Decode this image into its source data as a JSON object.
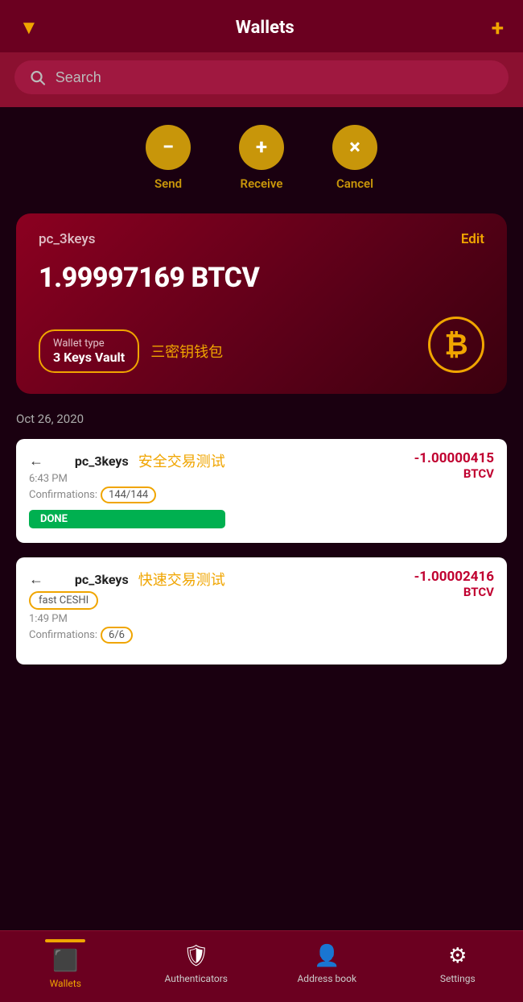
{
  "header": {
    "title": "Wallets",
    "filter_icon": "▼",
    "add_icon": "+"
  },
  "search": {
    "placeholder": "Search"
  },
  "actions": [
    {
      "icon": "−",
      "label": "Send"
    },
    {
      "icon": "+",
      "label": "Receive"
    },
    {
      "icon": "×",
      "label": "Cancel"
    }
  ],
  "wallet_card": {
    "name": "pc_3keys",
    "edit_label": "Edit",
    "balance": "1.99997169 BTCV",
    "type_label": "Wallet type",
    "type_value": "3 Keys Vault",
    "type_chinese": "三密钥钱包",
    "bitcoin_symbol": "₿"
  },
  "transactions": {
    "date": "Oct 26, 2020",
    "items": [
      {
        "wallet": "pc_3keys",
        "chinese": "安全交易测试",
        "time": "6:43 PM",
        "confirmations_label": "Confirmations:",
        "confirmations": "144/144",
        "status": "DONE",
        "amount": "-1.00000415",
        "currency": "BTCV"
      },
      {
        "wallet": "pc_3keys",
        "chinese": "快速交易测试",
        "memo": "fast CESHI",
        "time": "1:49 PM",
        "confirmations_label": "Confirmations:",
        "confirmations": "6/6",
        "amount": "-1.00002416",
        "currency": "BTCV"
      }
    ]
  },
  "bottom_nav": [
    {
      "id": "wallets",
      "label": "Wallets",
      "icon": "▦",
      "active": true
    },
    {
      "id": "authenticators",
      "label": "Authenticators",
      "icon": "🛡",
      "active": false
    },
    {
      "id": "address-book",
      "label": "Address book",
      "icon": "👤",
      "active": false
    },
    {
      "id": "settings",
      "label": "Settings",
      "icon": "⚙",
      "active": false
    }
  ]
}
